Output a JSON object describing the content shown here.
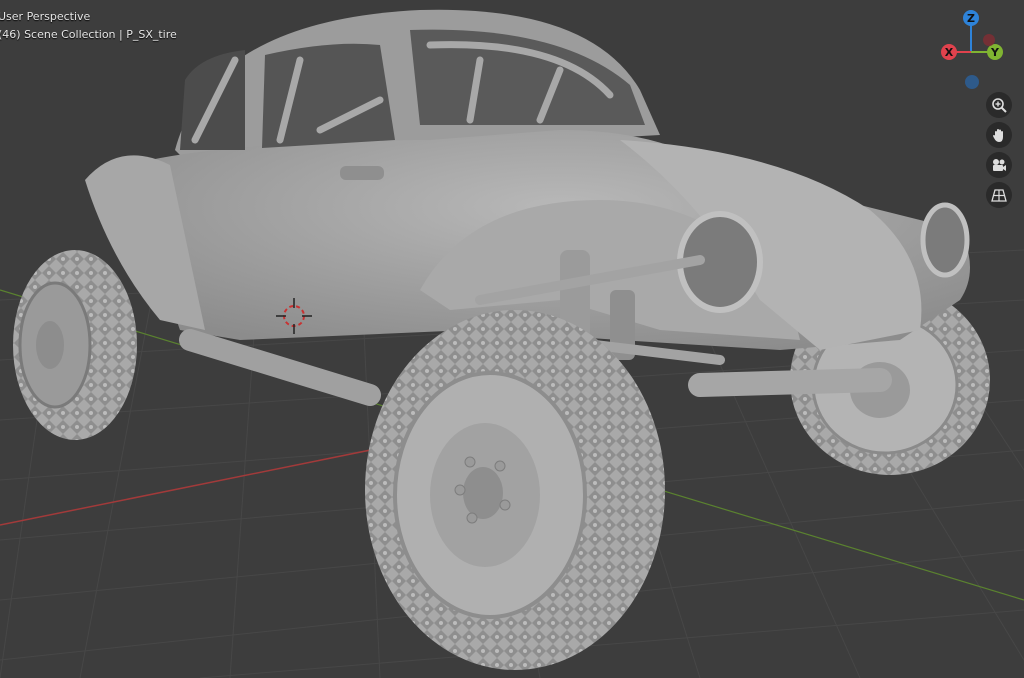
{
  "viewport": {
    "view_label": "User Perspective",
    "collection_label": "(46) Scene Collection | P_SX_tire"
  },
  "gizmo": {
    "z_label": "Z",
    "y_label": "Y",
    "x_label": "X",
    "colors": {
      "x": "#e0424d",
      "y": "#80b432",
      "z": "#2e83d9"
    }
  },
  "nav_buttons": [
    {
      "name": "zoom-icon"
    },
    {
      "name": "hand-pan-icon"
    },
    {
      "name": "camera-icon"
    },
    {
      "name": "grid-ortho-icon"
    }
  ]
}
